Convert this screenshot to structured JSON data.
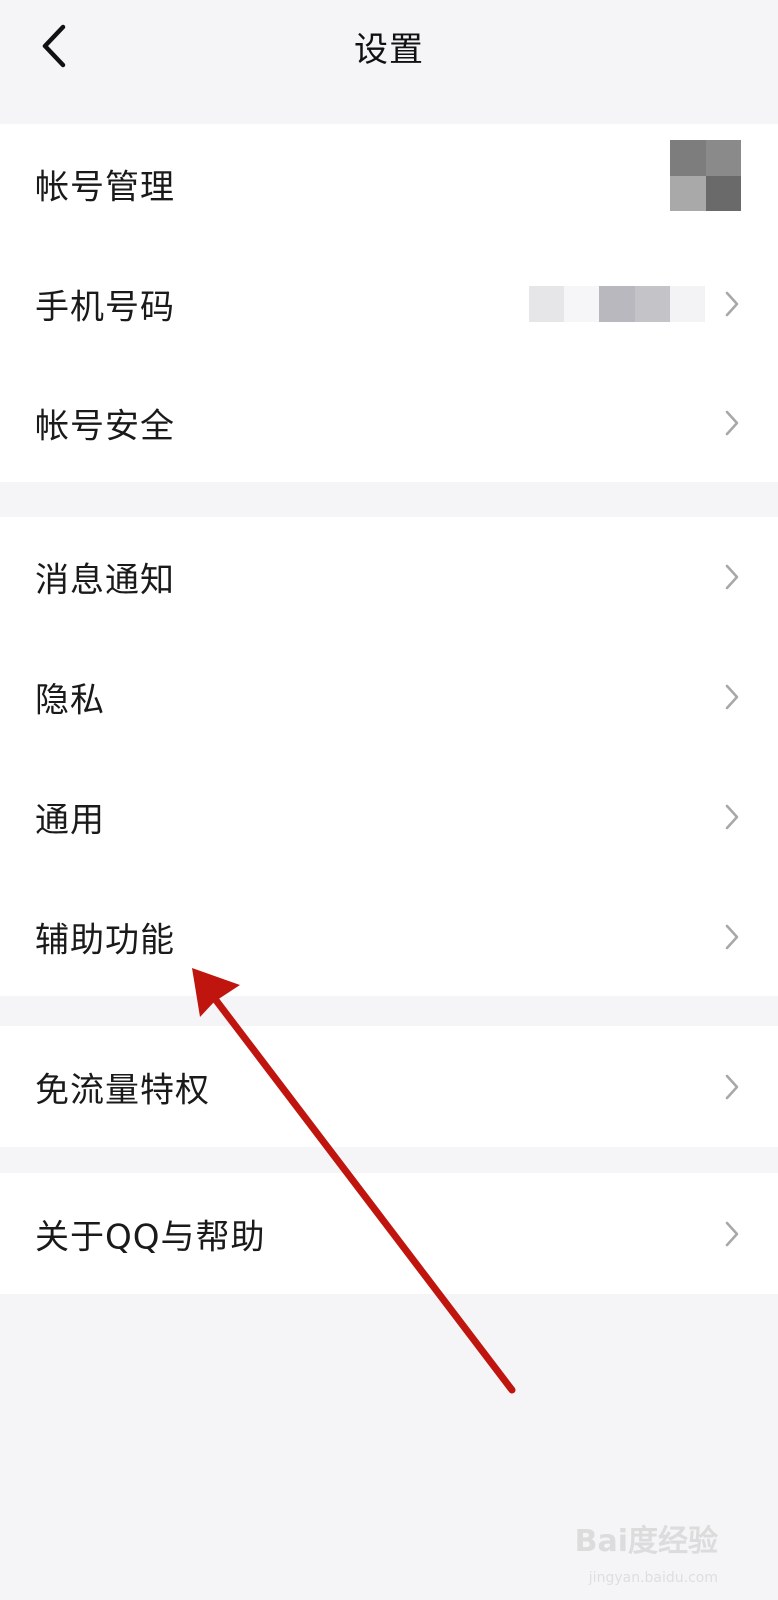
{
  "header": {
    "title": "设置",
    "back_icon": "chevron-left-icon"
  },
  "groups": [
    {
      "items": [
        {
          "label": "帐号管理",
          "trailing": "avatar"
        },
        {
          "label": "手机号码",
          "trailing": "phone-redacted"
        },
        {
          "label": "帐号安全"
        }
      ]
    },
    {
      "items": [
        {
          "label": "消息通知"
        },
        {
          "label": "隐私"
        },
        {
          "label": "通用"
        },
        {
          "label": "辅助功能"
        }
      ]
    },
    {
      "items": [
        {
          "label": "免流量特权"
        }
      ]
    },
    {
      "items": [
        {
          "label": "关于QQ与帮助"
        }
      ]
    }
  ],
  "annotation": {
    "color": "#c0150f",
    "target": "辅助功能"
  },
  "watermark": {
    "text": "Bai度经验",
    "sub": "jingyan.baidu.com"
  }
}
